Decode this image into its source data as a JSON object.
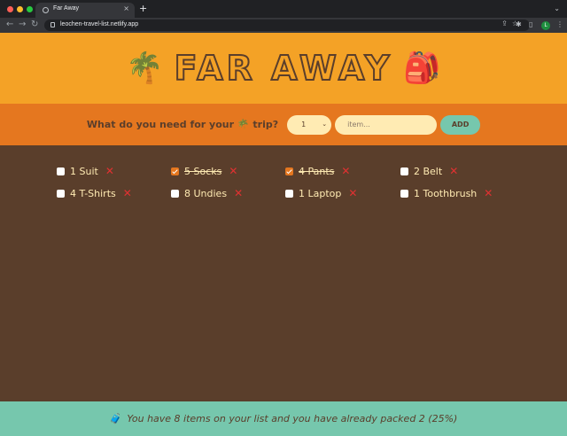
{
  "browser": {
    "tab_title": "Far Away",
    "tab_close": "×",
    "new_tab": "+",
    "url": "leochen-travel-list.netlify.app",
    "back": "←",
    "forward": "→",
    "reload": "↻",
    "profile_initial": "L",
    "tab_chevron": "⌄",
    "omnibox_icons": "⇪☆",
    "extensions": "✱",
    "sidebar": "▯",
    "menu": "⋮",
    "traffic_colors": [
      "#ff5f57",
      "#febc2e",
      "#28c840"
    ]
  },
  "header": {
    "logo_left_emoji": "🌴",
    "title": "Far Away",
    "logo_right_emoji": "🎒"
  },
  "form": {
    "label": "What do you need for your 🌴 trip?",
    "quantity_value": "1",
    "quantity_chevron": "⌄",
    "item_placeholder": "item...",
    "add_label": "ADD"
  },
  "items": [
    {
      "label": "1 Suit",
      "packed": false
    },
    {
      "label": "5 Socks",
      "packed": true
    },
    {
      "label": "4 Pants",
      "packed": true
    },
    {
      "label": "2 Belt",
      "packed": false
    },
    {
      "label": "4 T-Shirts",
      "packed": false
    },
    {
      "label": "8 Undies",
      "packed": false
    },
    {
      "label": "1 Laptop",
      "packed": false
    },
    {
      "label": "1 Toothbrush",
      "packed": false
    }
  ],
  "delete_glyph": "✕",
  "stats": {
    "emoji": "🧳",
    "text": "You have 8 items on your list and you have already packed 2 (25%)"
  },
  "colors": {
    "header": "#f4a226",
    "form": "#e5771f",
    "list": "#5a3e2b",
    "stats": "#76c7ad",
    "input": "#ffebb3",
    "delete": "#e03131"
  }
}
